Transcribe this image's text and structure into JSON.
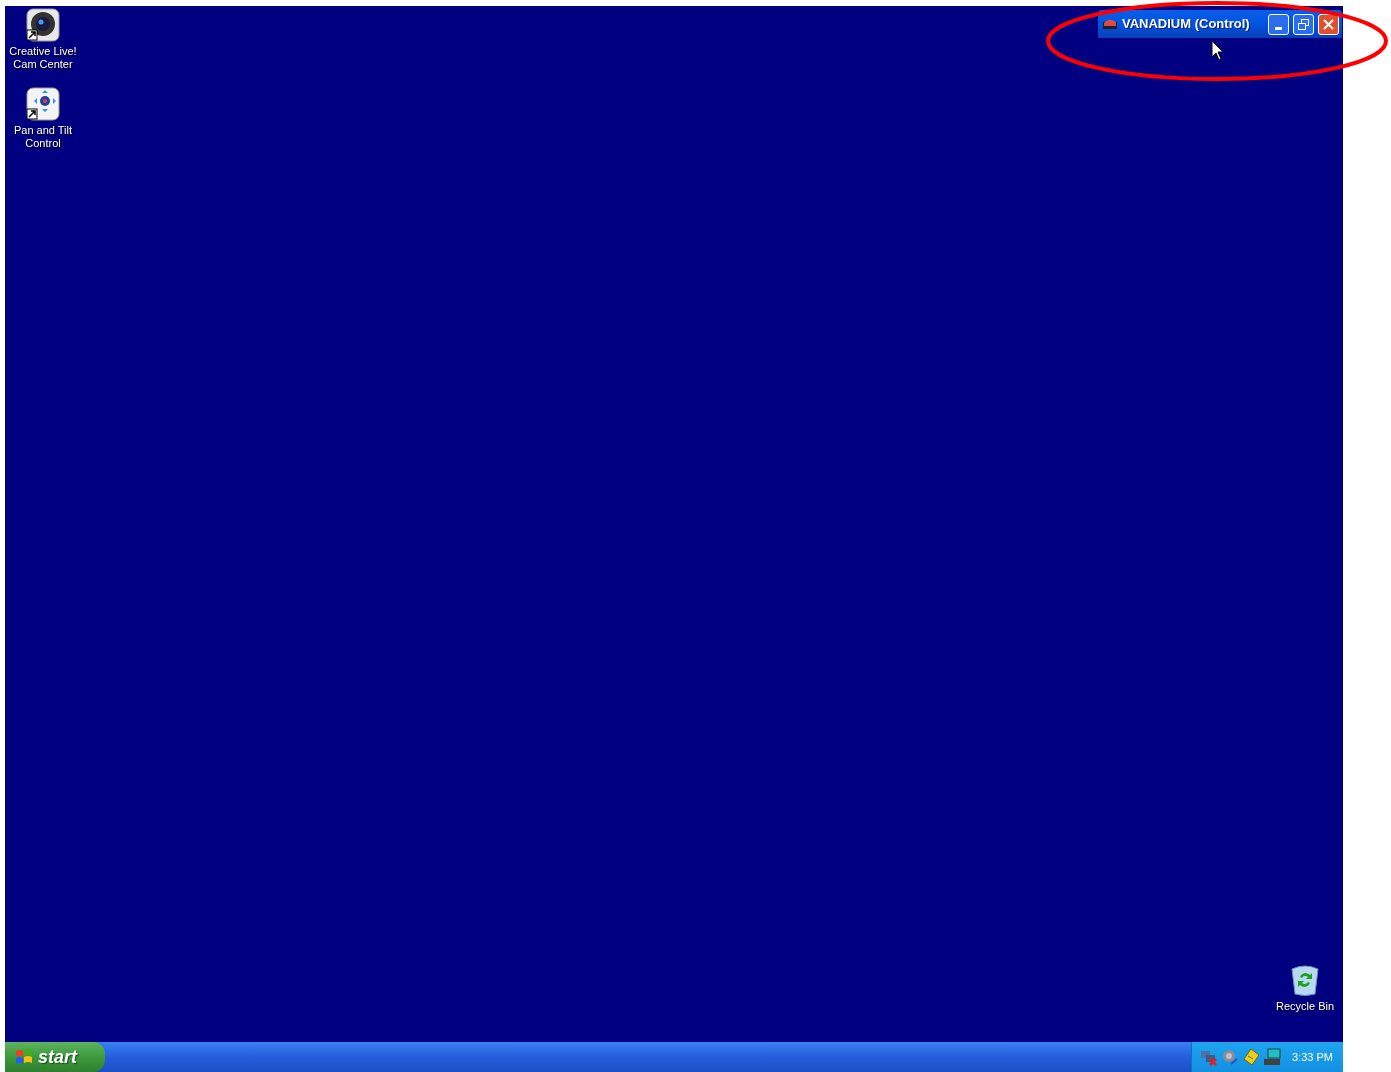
{
  "desktop_icons": [
    {
      "kind": "camera",
      "label": "Creative Live! Cam Center"
    },
    {
      "kind": "pan-tilt",
      "label": "Pan and Tilt Control"
    },
    {
      "kind": "recycle-bin",
      "label": "Recycle Bin"
    }
  ],
  "minimized_window": {
    "title": "VANADIUM (Control)"
  },
  "taskbar": {
    "start_label": "start",
    "clock": "3:33 PM"
  }
}
